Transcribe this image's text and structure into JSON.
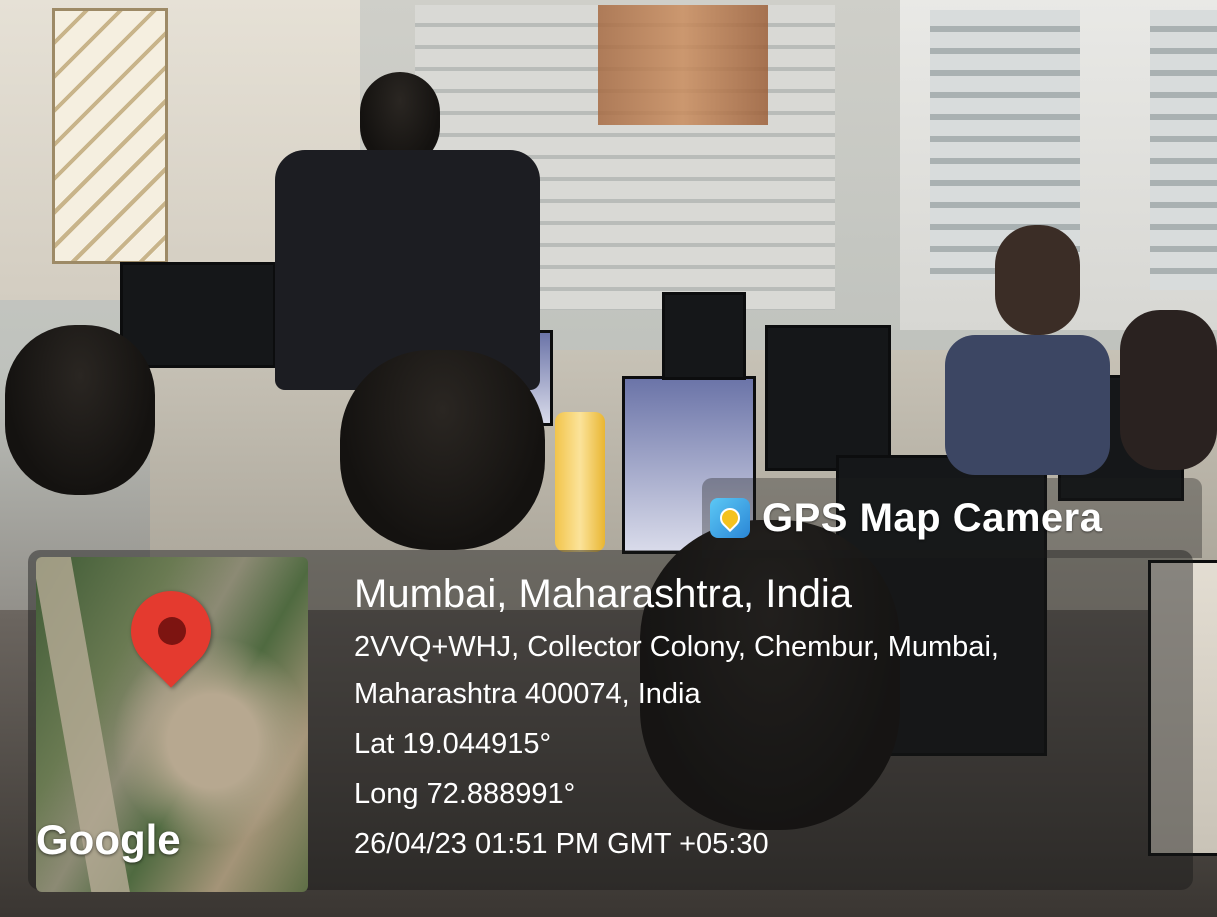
{
  "overlay": {
    "app_icon": "gps-map-camera-icon",
    "app_name": "GPS Map Camera",
    "map": {
      "brand": "Google",
      "pin_icon": "map-pin-icon",
      "pin_color": "#e43a2f"
    },
    "location_title": "Mumbai, Maharashtra, India",
    "address_line_1": "2VVQ+WHJ, Collector Colony, Chembur, Mumbai,",
    "address_line_2": "Maharashtra 400074, India",
    "latitude": "Lat 19.044915°",
    "longitude": "Long 72.888991°",
    "timestamp": "26/04/23 01:51 PM GMT +05:30"
  }
}
